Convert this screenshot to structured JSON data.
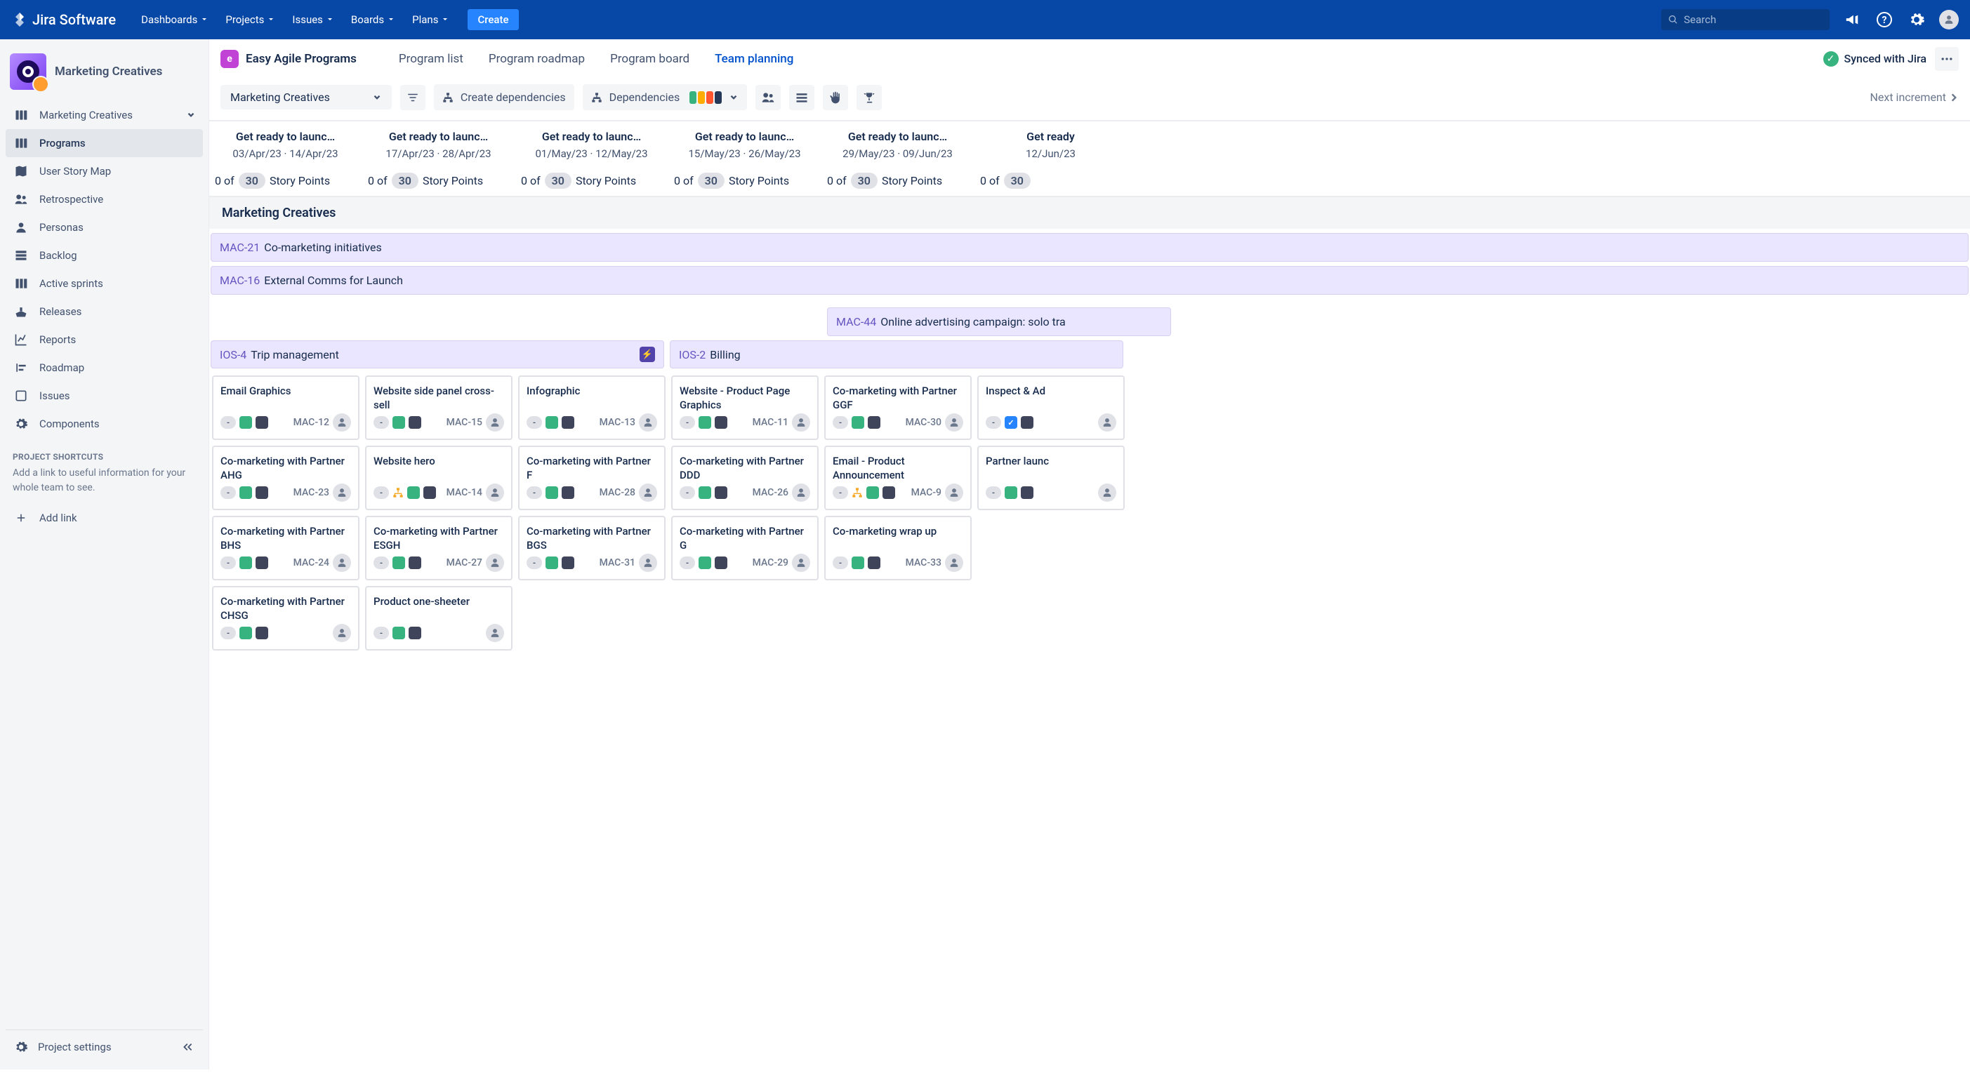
{
  "nav": {
    "logo": "Jira Software",
    "links": [
      "Dashboards",
      "Projects",
      "Issues",
      "Boards",
      "Plans"
    ],
    "create": "Create",
    "search_placeholder": "Search"
  },
  "project": {
    "name": "Marketing Creatives"
  },
  "sidebar": {
    "expand_item": "Marketing Creatives",
    "items": [
      {
        "label": "Programs",
        "icon": "board",
        "active": true
      },
      {
        "label": "User Story Map",
        "icon": "map"
      },
      {
        "label": "Retrospective",
        "icon": "people"
      },
      {
        "label": "Personas",
        "icon": "person"
      },
      {
        "label": "Backlog",
        "icon": "backlog"
      },
      {
        "label": "Active sprints",
        "icon": "columns"
      },
      {
        "label": "Releases",
        "icon": "ship"
      },
      {
        "label": "Reports",
        "icon": "chart"
      },
      {
        "label": "Roadmap",
        "icon": "roadmap"
      },
      {
        "label": "Issues",
        "icon": "issues"
      },
      {
        "label": "Components",
        "icon": "gear"
      }
    ],
    "shortcuts_hdr": "PROJECT SHORTCUTS",
    "shortcuts_txt": "Add a link to useful information for your whole team to see.",
    "add_link": "Add link",
    "settings": "Project settings"
  },
  "app": {
    "chip": "e",
    "name": "Easy Agile Programs",
    "tabs": [
      "Program list",
      "Program roadmap",
      "Program board",
      "Team planning"
    ],
    "active_tab": "Team planning",
    "synced": "Synced with Jira"
  },
  "toolbar": {
    "dropdown": "Marketing Creatives",
    "create_dep": "Create dependencies",
    "dependencies": "Dependencies",
    "dep_colors": [
      "#36B37E",
      "#FFAB00",
      "#FF5630",
      "#253858"
    ],
    "next": "Next increment"
  },
  "columns": [
    {
      "title": "Get ready to launc…",
      "dates": "03/Apr/23 · 14/Apr/23",
      "sp": "0 of",
      "cap": "30",
      "spl": "Story Points"
    },
    {
      "title": "Get ready to launc…",
      "dates": "17/Apr/23 · 28/Apr/23",
      "sp": "0 of",
      "cap": "30",
      "spl": "Story Points"
    },
    {
      "title": "Get ready to launc…",
      "dates": "01/May/23 · 12/May/23",
      "sp": "0 of",
      "cap": "30",
      "spl": "Story Points"
    },
    {
      "title": "Get ready to launc…",
      "dates": "15/May/23 · 26/May/23",
      "sp": "0 of",
      "cap": "30",
      "spl": "Story Points"
    },
    {
      "title": "Get ready to launc…",
      "dates": "29/May/23 · 09/Jun/23",
      "sp": "0 of",
      "cap": "30",
      "spl": "Story Points"
    },
    {
      "title": "Get ready",
      "dates": "12/Jun/23",
      "sp": "0 of",
      "cap": "30",
      "spl": ""
    }
  ],
  "team_band": "Marketing Creatives",
  "epics": [
    {
      "key": "MAC-21",
      "title": "Co-marketing initiatives"
    },
    {
      "key": "MAC-16",
      "title": "External Comms for Launch"
    }
  ],
  "partial_epic": {
    "key": "MAC-44",
    "title": "Online advertising campaign: solo tra"
  },
  "features": [
    {
      "key": "IOS-4",
      "title": "Trip management",
      "bolt": true,
      "span": 3
    },
    {
      "key": "IOS-2",
      "title": "Billing",
      "bolt": false,
      "span": 3
    }
  ],
  "cards": [
    [
      {
        "title": "Email Graphics",
        "key": "MAC-12"
      },
      {
        "title": "Co-marketing with Partner AHG",
        "key": "MAC-23"
      },
      {
        "title": "Co-marketing with Partner BHS",
        "key": "MAC-24"
      },
      {
        "title": "Co-marketing with Partner CHSG",
        "key": ""
      }
    ],
    [
      {
        "title": "Website side panel cross-sell",
        "key": "MAC-15"
      },
      {
        "title": "Website hero",
        "key": "MAC-14",
        "tree": true
      },
      {
        "title": "Co-marketing with Partner ESGH",
        "key": "MAC-27"
      },
      {
        "title": "Product one-sheeter",
        "key": ""
      }
    ],
    [
      {
        "title": "Infographic",
        "key": "MAC-13"
      },
      {
        "title": "Co-marketing with Partner F",
        "key": "MAC-28"
      },
      {
        "title": "Co-marketing with Partner BGS",
        "key": "MAC-31"
      }
    ],
    [
      {
        "title": "Website - Product Page Graphics",
        "key": "MAC-11"
      },
      {
        "title": "Co-marketing with Partner DDD",
        "key": "MAC-26"
      },
      {
        "title": "Co-marketing with Partner G",
        "key": "MAC-29"
      }
    ],
    [
      {
        "title": "Co-marketing with Partner GGF",
        "key": "MAC-30"
      },
      {
        "title": "Email - Product Announcement",
        "key": "MAC-9",
        "tree": true
      },
      {
        "title": "Co-marketing wrap up",
        "key": "MAC-33"
      }
    ],
    [
      {
        "title": "Inspect & Ad",
        "key": "",
        "blue": true
      },
      {
        "title": "Partner launc",
        "key": ""
      }
    ]
  ]
}
